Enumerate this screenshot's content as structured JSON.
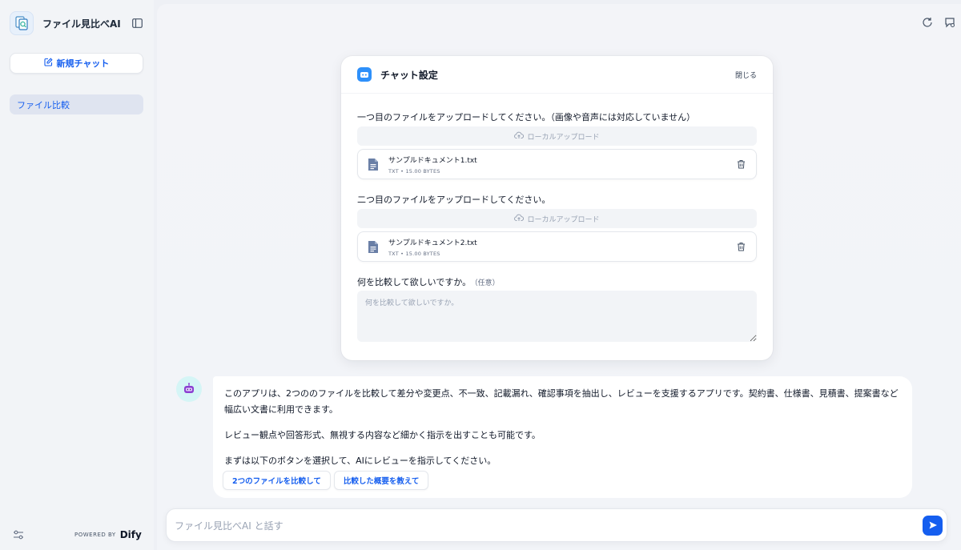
{
  "sidebar": {
    "app_title": "ファイル見比べAI",
    "new_chat_label": "新規チャット",
    "conversations": [
      {
        "label": "ファイル比較"
      }
    ],
    "powered_by": "POWERED BY",
    "brand": "Dify"
  },
  "chat_settings": {
    "title": "チャット設定",
    "close_label": "閉じる",
    "file1": {
      "label": "一つ目のファイルをアップロードしてください。（画像や音声には対応していません）",
      "upload_label": "ローカルアップロード",
      "file_name": "サンプルドキュメント1.txt",
      "file_info": "TXT • 15.00 BYTES"
    },
    "file2": {
      "label": "二つ目のファイルをアップロードしてください。",
      "upload_label": "ローカルアップロード",
      "file_name": "サンプルドキュメント2.txt",
      "file_info": "TXT • 15.00 BYTES"
    },
    "question": {
      "label": "何を比較して欲しいですか。",
      "optional": "（任意）",
      "placeholder": "何を比較して欲しいですか。",
      "value": ""
    }
  },
  "bot_message": {
    "paragraphs": [
      "このアプリは、2つののファイルを比較して差分や変更点、不一致、記載漏れ、確認事項を抽出し、レビューを支援するアプリです。契約書、仕様書、見積書、提案書など幅広い文書に利用できます。",
      "レビュー観点や回答形式、無視する内容など細かく指示を出すことも可能です。",
      "まずは以下のボタンを選択して、AIにレビューを指示してください。"
    ],
    "suggestions": [
      "2つのファイルを比較して",
      "比較した概要を教えて"
    ]
  },
  "composer": {
    "placeholder": "ファイル見比べAI と話す",
    "value": ""
  },
  "colors": {
    "accent": "#155eef",
    "sidebar_bg": "#f2f4f7",
    "selected_item_bg": "#dfe4f0",
    "main_bg": "#f3f4f8"
  },
  "icons": {
    "app": "document-compare-icon",
    "collapse": "sidebar-collapse-icon",
    "new_chat": "edit-icon",
    "settings": "sliders-icon",
    "restart": "refresh-icon",
    "chat_settings": "chat-settings-icon",
    "upload": "cloud-upload-icon",
    "file": "file-text-icon",
    "delete": "trash-icon",
    "bot": "robot-icon",
    "send": "send-icon"
  }
}
